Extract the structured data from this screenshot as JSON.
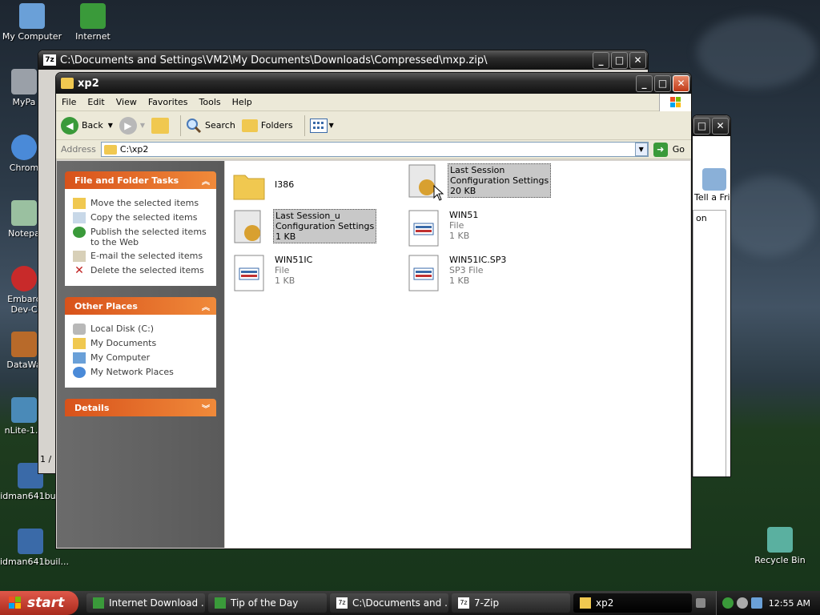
{
  "desktop_icons": [
    {
      "label": "My Computer",
      "color": "#6aa0d8"
    },
    {
      "label": "Internet Downlo...",
      "color": "#3a9a3a"
    },
    {
      "label": "MyPa",
      "color": "#9aa0a8"
    },
    {
      "label": "Chrom",
      "color": "#4a8ad8"
    },
    {
      "label": "Notepa",
      "color": "#9ac0a0"
    },
    {
      "label": "Embarc Dev-C",
      "color": "#c82a2a"
    },
    {
      "label": "DataWa",
      "color": "#b86a2a"
    },
    {
      "label": "nLite-1.4",
      "color": "#4a8ab8"
    },
    {
      "label": "idman641buil",
      "color": "#3a6aa8"
    },
    {
      "label": "idman641buil...",
      "color": "#3a6aa8"
    },
    {
      "label": "Recycle Bin",
      "color": "#5ab0a0"
    }
  ],
  "back_window": {
    "title": "C:\\Documents and Settings\\VM2\\My Documents\\Downloads\\Compressed\\mxp.zip\\",
    "status": "1 /"
  },
  "right_window": {
    "label": "Tell a Frie",
    "col": "on"
  },
  "main_window": {
    "title": "xp2",
    "menu": [
      "File",
      "Edit",
      "View",
      "Favorites",
      "Tools",
      "Help"
    ],
    "toolbar": {
      "back": "Back",
      "search": "Search",
      "folders": "Folders"
    },
    "address_label": "Address",
    "address_value": "C:\\xp2",
    "go_label": "Go"
  },
  "panels": {
    "file_tasks": {
      "title": "File and Folder Tasks",
      "items": [
        "Move the selected items",
        "Copy the selected items",
        "Publish the selected items to the Web",
        "E-mail the selected items",
        "Delete the selected items"
      ]
    },
    "other_places": {
      "title": "Other Places",
      "items": [
        "Local Disk (C:)",
        "My Documents",
        "My Computer",
        "My Network Places"
      ]
    },
    "details": {
      "title": "Details"
    }
  },
  "files": [
    {
      "name": "I386",
      "line2": "",
      "line3": "",
      "kind": "folder"
    },
    {
      "name": "Last Session",
      "line2": "Configuration Settings",
      "line3": "20 KB",
      "kind": "config"
    },
    {
      "name": "Last Session_u",
      "line2": "Configuration Settings",
      "line3": "1 KB",
      "kind": "config"
    },
    {
      "name": "WIN51",
      "line2": "File",
      "line3": "1 KB",
      "kind": "file"
    },
    {
      "name": "WIN51IC",
      "line2": "File",
      "line3": "1 KB",
      "kind": "file"
    },
    {
      "name": "WIN51IC.SP3",
      "line2": "SP3 File",
      "line3": "1 KB",
      "kind": "file"
    }
  ],
  "taskbar": {
    "start": "start",
    "tasks": [
      "Internet Download ...",
      "Tip of the Day",
      "C:\\Documents and ...",
      "7-Zip",
      "xp2"
    ],
    "clock": "12:55 AM"
  }
}
